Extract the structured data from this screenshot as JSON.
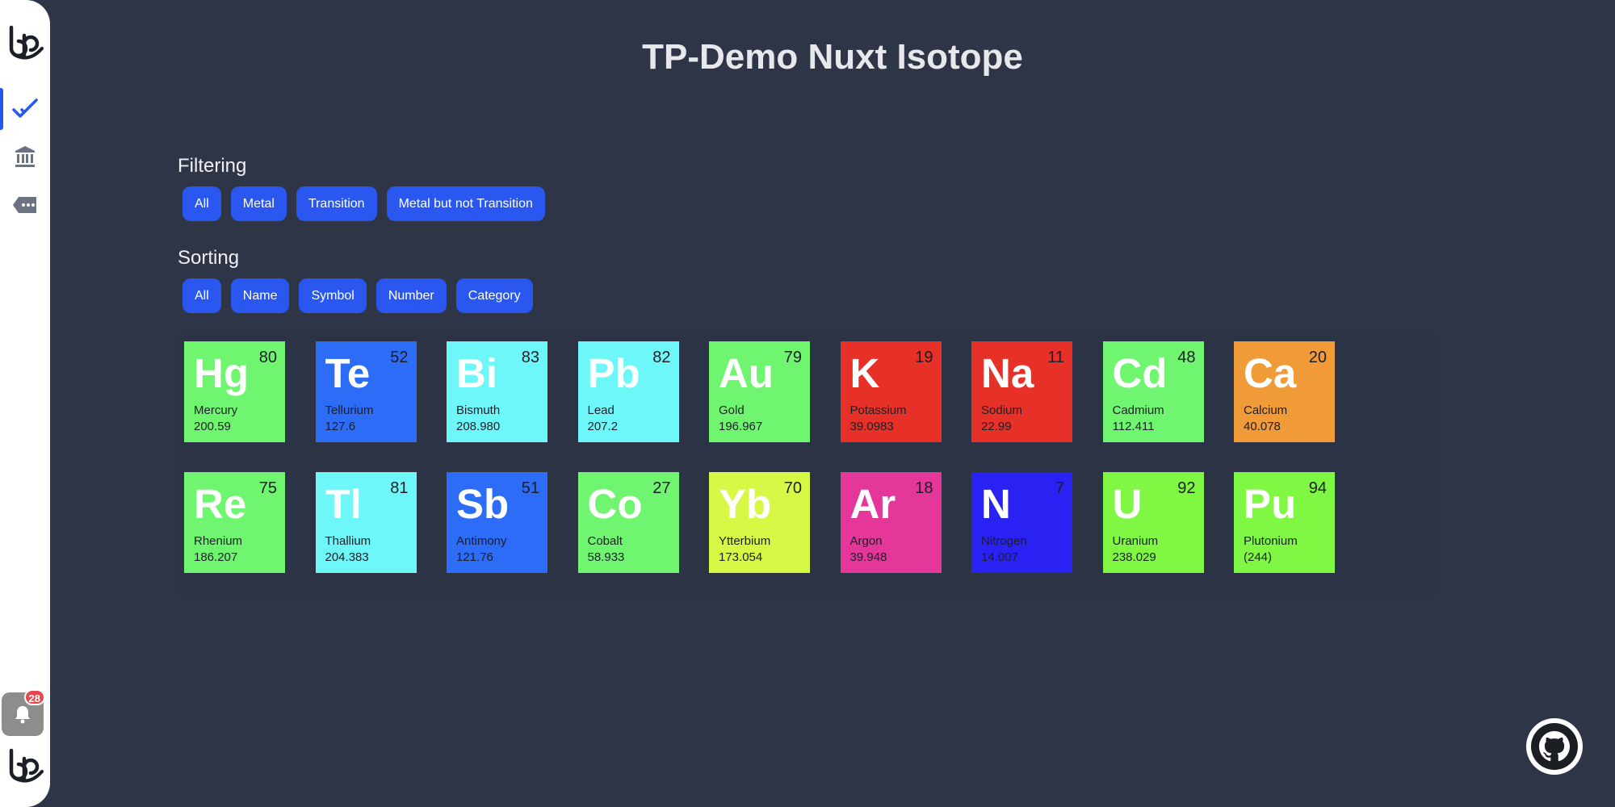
{
  "title": "TP-Demo Nuxt Isotope",
  "filtering": {
    "label": "Filtering",
    "buttons": [
      "All",
      "Metal",
      "Transition",
      "Metal but not Transition"
    ]
  },
  "sorting": {
    "label": "Sorting",
    "buttons": [
      "All",
      "Name",
      "Symbol",
      "Number",
      "Category"
    ]
  },
  "sidebar": {
    "icons": [
      "logo-icon",
      "checkmark-icon",
      "bank-icon",
      "tag-more-icon"
    ],
    "notification_count": "28"
  },
  "elements": [
    {
      "symbol": "Hg",
      "number": "80",
      "name": "Mercury",
      "mass": "200.59",
      "color": "#6ff56f"
    },
    {
      "symbol": "Te",
      "number": "52",
      "name": "Tellurium",
      "mass": "127.6",
      "color": "#2c6cf6"
    },
    {
      "symbol": "Bi",
      "number": "83",
      "name": "Bismuth",
      "mass": "208.980",
      "color": "#6ef7f9"
    },
    {
      "symbol": "Pb",
      "number": "82",
      "name": "Lead",
      "mass": "207.2",
      "color": "#6ef7f9"
    },
    {
      "symbol": "Au",
      "number": "79",
      "name": "Gold",
      "mass": "196.967",
      "color": "#6ff56f"
    },
    {
      "symbol": "K",
      "number": "19",
      "name": "Potassium",
      "mass": "39.0983",
      "color": "#e73027"
    },
    {
      "symbol": "Na",
      "number": "11",
      "name": "Sodium",
      "mass": "22.99",
      "color": "#e73027"
    },
    {
      "symbol": "Cd",
      "number": "48",
      "name": "Cadmium",
      "mass": "112.411",
      "color": "#6ff56f"
    },
    {
      "symbol": "Ca",
      "number": "20",
      "name": "Calcium",
      "mass": "40.078",
      "color": "#f19a38"
    },
    {
      "symbol": "Re",
      "number": "75",
      "name": "Rhenium",
      "mass": "186.207",
      "color": "#6ff56f"
    },
    {
      "symbol": "Tl",
      "number": "81",
      "name": "Thallium",
      "mass": "204.383",
      "color": "#6ef7f9"
    },
    {
      "symbol": "Sb",
      "number": "51",
      "name": "Antimony",
      "mass": "121.76",
      "color": "#2c6cf6"
    },
    {
      "symbol": "Co",
      "number": "27",
      "name": "Cobalt",
      "mass": "58.933",
      "color": "#6ff56f"
    },
    {
      "symbol": "Yb",
      "number": "70",
      "name": "Ytterbium",
      "mass": "173.054",
      "color": "#d7f945"
    },
    {
      "symbol": "Ar",
      "number": "18",
      "name": "Argon",
      "mass": "39.948",
      "color": "#e5369a"
    },
    {
      "symbol": "N",
      "number": "7",
      "name": "Nitrogen",
      "mass": "14.007",
      "color": "#2a21f3"
    },
    {
      "symbol": "U",
      "number": "92",
      "name": "Uranium",
      "mass": "238.029",
      "color": "#7ff743"
    },
    {
      "symbol": "Pu",
      "number": "94",
      "name": "Plutonium",
      "mass": "(244)",
      "color": "#7ff743"
    }
  ]
}
